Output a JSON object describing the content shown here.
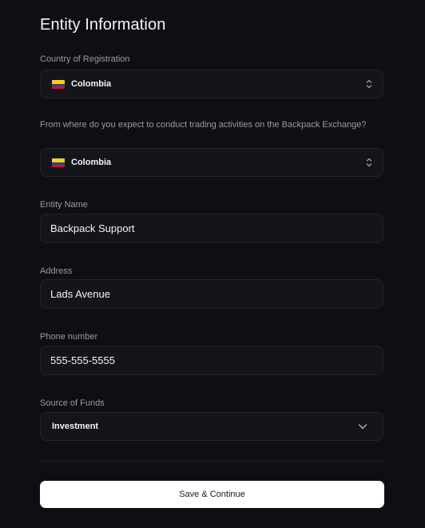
{
  "page": {
    "title": "Entity Information",
    "save_label": "Save & Continue"
  },
  "colors": {
    "background": "#0e0f14",
    "field_bg": "#14151b",
    "field_border": "#22232b",
    "label": "#9a9ba6",
    "button_bg": "#ffffff"
  },
  "fields": {
    "country": {
      "label": "Country of Registration",
      "value": "Colombia",
      "icon": "colombia-flag-icon"
    },
    "trading_country": {
      "label": "From where do you expect to conduct trading activities on the Backpack Exchange?",
      "value": "Colombia",
      "icon": "colombia-flag-icon"
    },
    "entity_name": {
      "label": "Entity Name",
      "value": "Backpack Support"
    },
    "address": {
      "label": "Address",
      "value": "Lads Avenue"
    },
    "phone": {
      "label": "Phone number",
      "value": "555-555-5555"
    },
    "source_of_funds": {
      "label": "Source of Funds",
      "value": "Investment",
      "icon": "chevron-down-icon"
    }
  }
}
